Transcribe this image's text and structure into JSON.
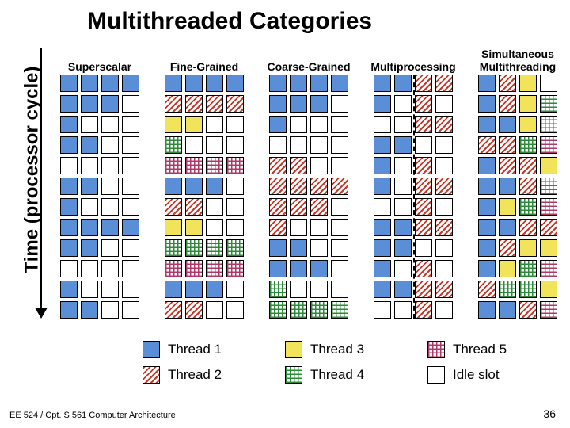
{
  "title": "Multithreaded Categories",
  "y_axis_label": "Time (processor cycle)",
  "columns": [
    {
      "label": "Superscalar",
      "dual": false,
      "grid": [
        [
          "t1",
          "t1",
          "t1",
          "t1"
        ],
        [
          "t1",
          "t1",
          "t1",
          "idle"
        ],
        [
          "t1",
          "idle",
          "idle",
          "idle"
        ],
        [
          "t1",
          "t1",
          "idle",
          "idle"
        ],
        [
          "idle",
          "idle",
          "idle",
          "idle"
        ],
        [
          "t1",
          "t1",
          "idle",
          "idle"
        ],
        [
          "t1",
          "idle",
          "idle",
          "idle"
        ],
        [
          "t1",
          "t1",
          "t1",
          "t1"
        ],
        [
          "t1",
          "t1",
          "idle",
          "idle"
        ],
        [
          "idle",
          "idle",
          "idle",
          "idle"
        ],
        [
          "t1",
          "idle",
          "idle",
          "idle"
        ],
        [
          "t1",
          "t1",
          "idle",
          "idle"
        ]
      ]
    },
    {
      "label": "Fine-Grained",
      "dual": false,
      "grid": [
        [
          "t1",
          "t1",
          "t1",
          "t1"
        ],
        [
          "t2",
          "t2",
          "t2",
          "t2"
        ],
        [
          "t3",
          "t3",
          "idle",
          "idle"
        ],
        [
          "t4",
          "idle",
          "idle",
          "idle"
        ],
        [
          "t5",
          "t5",
          "t5",
          "t5"
        ],
        [
          "t1",
          "t1",
          "t1",
          "idle"
        ],
        [
          "t2",
          "t2",
          "idle",
          "idle"
        ],
        [
          "t3",
          "t3",
          "idle",
          "idle"
        ],
        [
          "t4",
          "t4",
          "t4",
          "t4"
        ],
        [
          "t5",
          "t5",
          "t5",
          "t5"
        ],
        [
          "t1",
          "t1",
          "t1",
          "idle"
        ],
        [
          "t2",
          "t2",
          "idle",
          "idle"
        ]
      ]
    },
    {
      "label": "Coarse-Grained",
      "dual": false,
      "grid": [
        [
          "t1",
          "t1",
          "t1",
          "t1"
        ],
        [
          "t1",
          "t1",
          "t1",
          "idle"
        ],
        [
          "t1",
          "idle",
          "idle",
          "idle"
        ],
        [
          "idle",
          "idle",
          "idle",
          "idle"
        ],
        [
          "t2",
          "t2",
          "idle",
          "idle"
        ],
        [
          "t2",
          "t2",
          "t2",
          "t2"
        ],
        [
          "t2",
          "t2",
          "t2",
          "idle"
        ],
        [
          "t2",
          "idle",
          "idle",
          "idle"
        ],
        [
          "t1",
          "t1",
          "idle",
          "idle"
        ],
        [
          "t1",
          "t1",
          "t1",
          "idle"
        ],
        [
          "t4",
          "idle",
          "idle",
          "idle"
        ],
        [
          "t4",
          "t4",
          "t4",
          "t4"
        ]
      ]
    },
    {
      "label": "Multiprocessing",
      "dual": true,
      "grid": [
        [
          "t1",
          "t1",
          "t2",
          "t2"
        ],
        [
          "t1",
          "idle",
          "t2",
          "idle"
        ],
        [
          "idle",
          "idle",
          "t2",
          "t2"
        ],
        [
          "t1",
          "t1",
          "idle",
          "idle"
        ],
        [
          "t1",
          "idle",
          "t2",
          "idle"
        ],
        [
          "t1",
          "idle",
          "t2",
          "t2"
        ],
        [
          "idle",
          "idle",
          "t2",
          "idle"
        ],
        [
          "t1",
          "t1",
          "t2",
          "t2"
        ],
        [
          "t1",
          "t1",
          "idle",
          "idle"
        ],
        [
          "t1",
          "idle",
          "t2",
          "idle"
        ],
        [
          "t1",
          "t1",
          "t2",
          "t2"
        ],
        [
          "idle",
          "idle",
          "t2",
          "idle"
        ]
      ]
    },
    {
      "label": "Simultaneous\nMultithreading",
      "dual": false,
      "grid": [
        [
          "t1",
          "t2",
          "t3",
          "idle"
        ],
        [
          "t1",
          "t2",
          "t3",
          "t4"
        ],
        [
          "t1",
          "t1",
          "t3",
          "t5"
        ],
        [
          "t2",
          "t2",
          "t4",
          "t5"
        ],
        [
          "t1",
          "t2",
          "t2",
          "t3"
        ],
        [
          "t1",
          "t1",
          "t2",
          "t4"
        ],
        [
          "t1",
          "t3",
          "t4",
          "t5"
        ],
        [
          "t1",
          "t1",
          "t2",
          "t2"
        ],
        [
          "t1",
          "t2",
          "t3",
          "t3"
        ],
        [
          "t1",
          "t3",
          "t4",
          "t5"
        ],
        [
          "t2",
          "t4",
          "t4",
          "t3"
        ],
        [
          "t1",
          "t1",
          "t2",
          "t5"
        ]
      ]
    }
  ],
  "legend": [
    {
      "cls": "t1",
      "label": "Thread 1"
    },
    {
      "cls": "t3",
      "label": "Thread 3"
    },
    {
      "cls": "t5",
      "label": "Thread 5"
    },
    {
      "cls": "t2",
      "label": "Thread 2"
    },
    {
      "cls": "t4",
      "label": "Thread 4"
    },
    {
      "cls": "idle",
      "label": "Idle slot"
    }
  ],
  "footer": {
    "left": "EE 524 / Cpt. S 561 Computer Architecture",
    "right": "36"
  }
}
